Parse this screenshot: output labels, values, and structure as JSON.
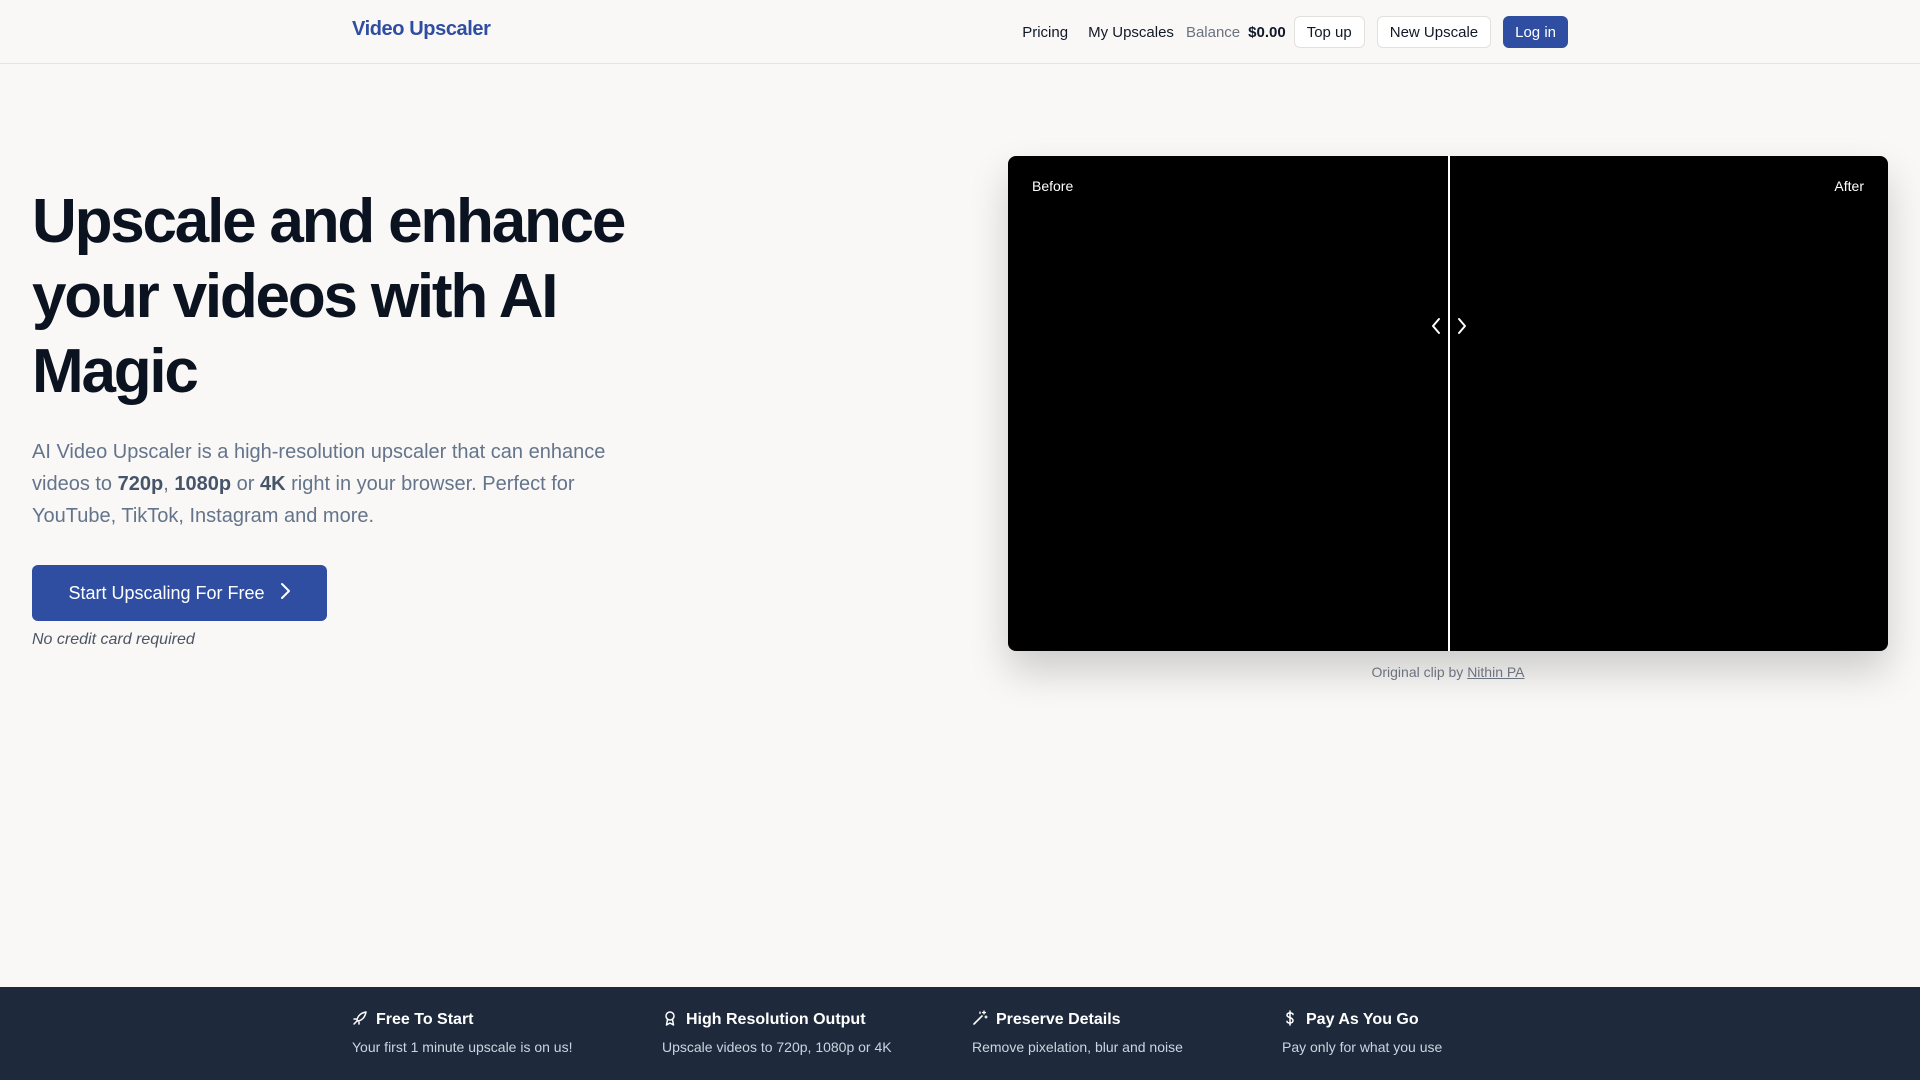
{
  "header": {
    "logo": "Video Upscaler",
    "nav": {
      "pricing": "Pricing",
      "my_upscales": "My Upscales",
      "balance_label": "Balance",
      "balance_value": "$0.00",
      "top_up": "Top up",
      "new_upscale": "New Upscale",
      "log_in": "Log in"
    }
  },
  "hero": {
    "title": "Upscale and enhance your videos with AI Magic",
    "desc_1": "AI Video Upscaler is a high-resolution upscaler that can enhance videos to ",
    "res_720": "720p",
    "sep_comma": ", ",
    "res_1080": "1080p",
    "sep_or": " or ",
    "res_4k": "4K",
    "desc_2": " right in your browser. Perfect for YouTube, TikTok, Instagram and more.",
    "cta_label": "Start Upscaling For Free",
    "cta_note": "No credit card required"
  },
  "comparison": {
    "before_label": "Before",
    "after_label": "After",
    "divider_position": 0.5,
    "credit_prefix": "Original clip by ",
    "credit_author": "Nithin PA"
  },
  "features": [
    {
      "icon": "rocket-icon",
      "title": "Free To Start",
      "desc": "Your first 1 minute upscale is on us!"
    },
    {
      "icon": "award-icon",
      "title": "High Resolution Output",
      "desc": "Upscale videos to 720p, 1080p or 4K"
    },
    {
      "icon": "magic-wand-icon",
      "title": "Preserve Details",
      "desc": "Remove pixelation, blur and noise"
    },
    {
      "icon": "dollar-icon",
      "title": "Pay As You Go",
      "desc": "Pay only for what you use"
    }
  ],
  "colors": {
    "brand": "#2f4ea1",
    "background": "#f9f8f6",
    "footer_bar": "#1e293b"
  }
}
